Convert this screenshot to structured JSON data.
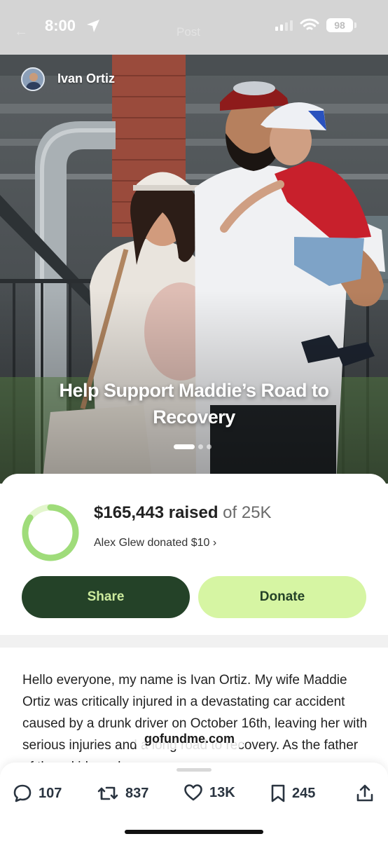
{
  "status_bar": {
    "time": "8:00",
    "battery": "98",
    "faint_title": "Post"
  },
  "post": {
    "author_name": "Ivan Ortiz",
    "title": "Help Support Maddie’s Road to Recovery",
    "carousel_pages": 3,
    "carousel_active": 1
  },
  "fundraiser": {
    "amount_raised": "$165,443 raised",
    "goal_text": "of 25K",
    "latest_donation": "Alex Glew donated $10",
    "share_label": "Share",
    "donate_label": "Donate",
    "story_text": "Hello everyone, my name is Ivan Ortiz. My wife Maddie Ortiz was critically injured in a devastating car accident caused by a drunk driver on October 16th, leaving her with serious injuries and a long road to recovery. As the father of three kids and a",
    "watermark": "gofundme.com",
    "progress_ring_fill": 0.85
  },
  "actions": {
    "replies": "107",
    "reposts": "837",
    "likes": "13K",
    "bookmarks": "245"
  },
  "colors": {
    "share_bg": "#244228",
    "donate_bg": "#d6f5a3",
    "ring_green": "#9fdc7a"
  }
}
